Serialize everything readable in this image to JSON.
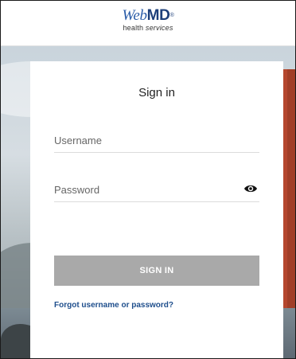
{
  "header": {
    "logo_web": "Web",
    "logo_md": "MD",
    "logo_health": "health",
    "logo_services": "services"
  },
  "signin": {
    "title": "Sign in",
    "username_placeholder": "Username",
    "password_placeholder": "Password",
    "button_label": "SIGN IN",
    "forgot_link": "Forgot username or password?"
  },
  "colors": {
    "brand_blue": "#2a5ca8",
    "button_disabled": "#a9a9a9",
    "link": "#1e4e8c"
  },
  "icons": {
    "password_toggle": "eye-icon"
  }
}
